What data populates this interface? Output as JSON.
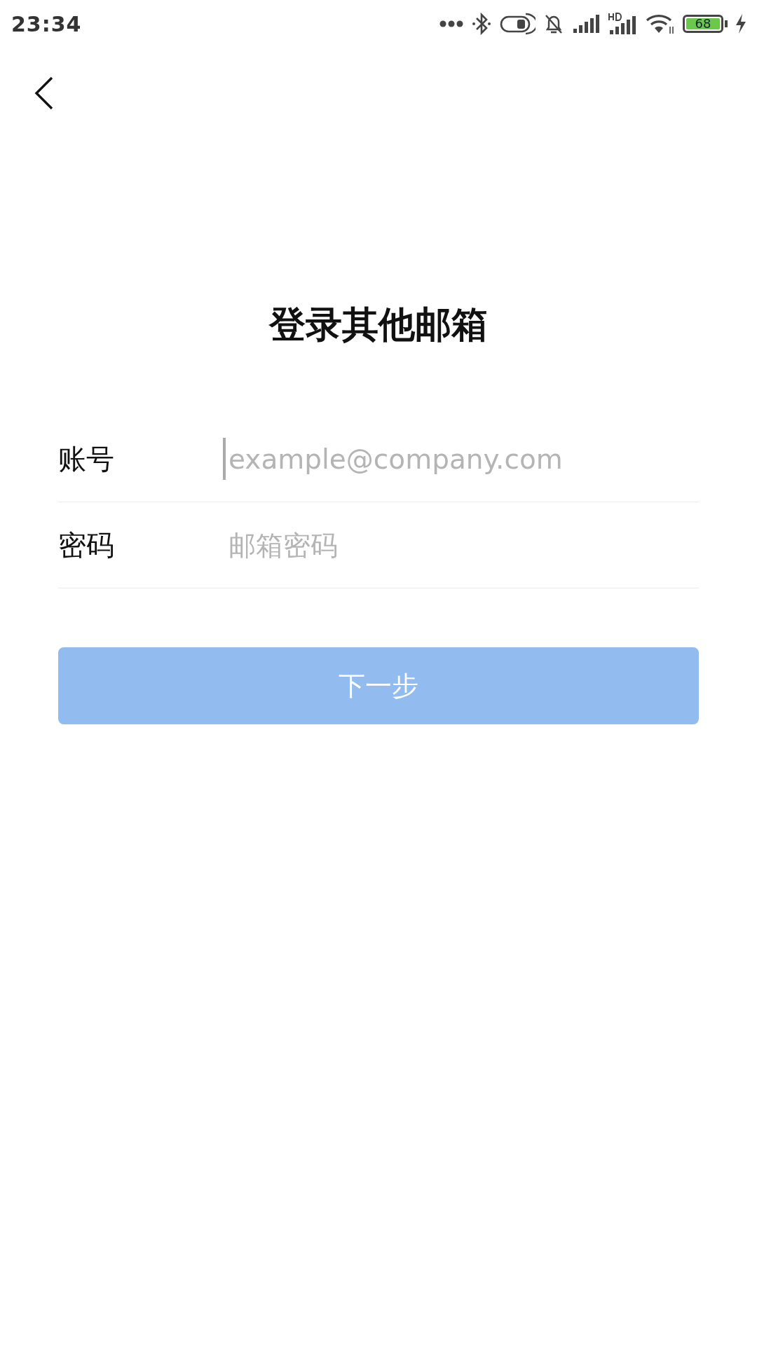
{
  "status_bar": {
    "time": "23:34",
    "battery": "68"
  },
  "title": "登录其他邮箱",
  "fields": [
    {
      "label": "账号",
      "placeholder": "example@company.com",
      "focused": true
    },
    {
      "label": "密码",
      "placeholder": "邮箱密码",
      "focused": false
    }
  ],
  "next_button": {
    "label": "下一步",
    "disabled": true
  }
}
